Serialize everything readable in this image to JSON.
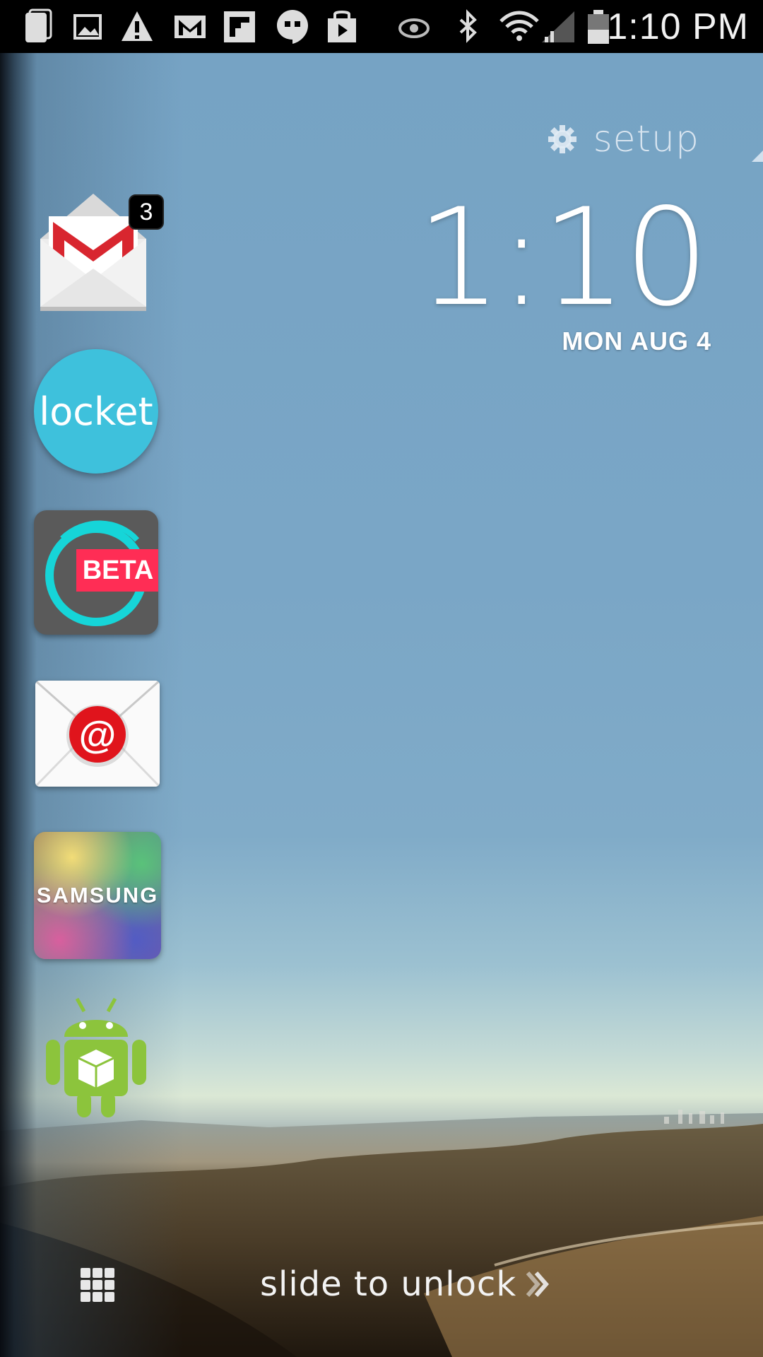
{
  "status_bar": {
    "time": "1:10 PM",
    "notification_icons": [
      "notes-icon",
      "image-icon",
      "warning-icon",
      "gmail-icon",
      "flipboard-icon",
      "hangouts-icon",
      "play-store-icon"
    ],
    "system_icons": [
      "eye-icon",
      "bluetooth-icon",
      "wifi-icon",
      "signal-icon",
      "battery-icon"
    ]
  },
  "setup": {
    "label": "setup"
  },
  "clock": {
    "time": "1:10",
    "date": "MON AUG 4"
  },
  "apps": [
    {
      "name": "gmail",
      "badge": "3"
    },
    {
      "name": "locket",
      "label": "locket"
    },
    {
      "name": "beta-app",
      "label": "BETA"
    },
    {
      "name": "email"
    },
    {
      "name": "samsung",
      "label": "SAMSUNG"
    },
    {
      "name": "android-app"
    }
  ],
  "bottom": {
    "unlock_label": "slide to unlock"
  }
}
